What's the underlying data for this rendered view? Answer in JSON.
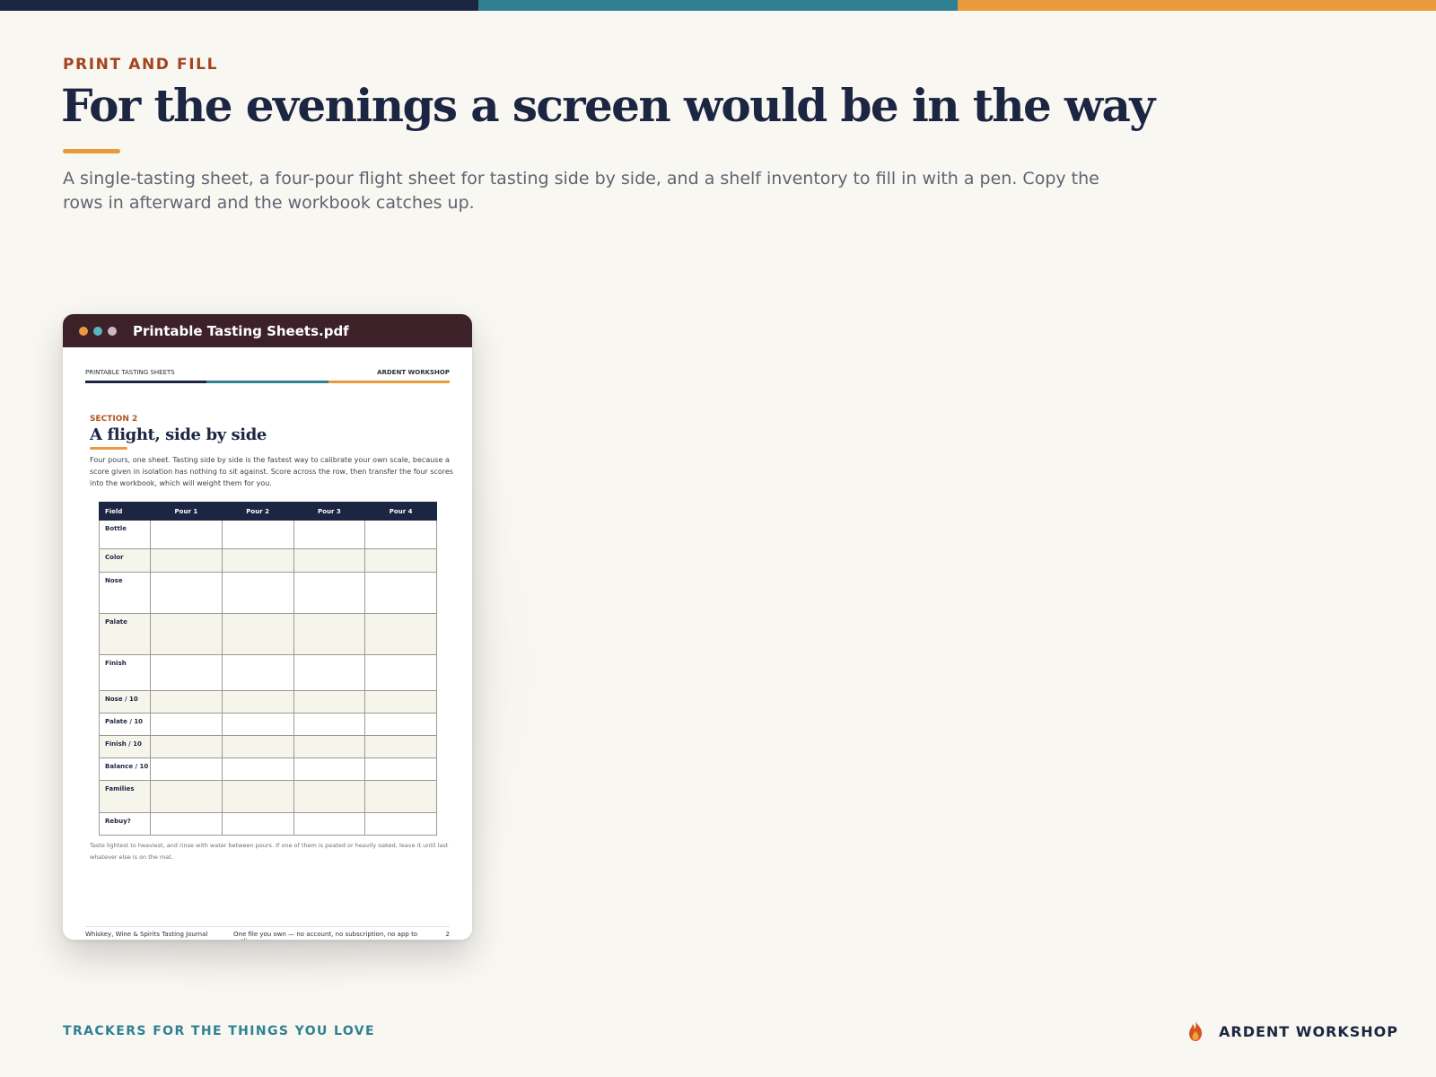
{
  "colors": {
    "navy": "#1c2541",
    "teal": "#2f8192",
    "orange": "#e89a3c",
    "rust": "#a4431f",
    "window_bar": "#3d2129"
  },
  "header": {
    "eyebrow": "PRINT AND FILL",
    "title": "For the evenings a screen would be in the way",
    "lead": "A single-tasting sheet, a four-pour flight sheet for tasting side by side, and a shelf inventory to fill in with a pen. Copy the rows in afterward and the workbook catches up."
  },
  "window": {
    "title": "Printable Tasting Sheets.pdf",
    "dots": [
      "#e89a3c",
      "#5ab6c2",
      "#c9b8c4"
    ]
  },
  "doc_page": {
    "header_left": "PRINTABLE TASTING SHEETS",
    "header_right": "ARDENT WORKSHOP",
    "section_label": "SECTION 2",
    "section_title": "A flight, side by side",
    "body": "Four pours, one sheet. Tasting side by side is the fastest way to calibrate your own scale, because a score given in isolation has nothing to sit against. Score across the row, then transfer the four scores into the workbook, which will weight them for you.",
    "table": {
      "headers": [
        "Field",
        "Pour 1",
        "Pour 2",
        "Pour 3",
        "Pour 4"
      ],
      "rows": [
        "Bottle",
        "Color",
        "Nose",
        "Palate",
        "Finish",
        "Nose / 10",
        "Palate / 10",
        "Finish / 10",
        "Balance / 10",
        "Families",
        "Rebuy?"
      ]
    },
    "note": "Taste lightest to heaviest, and rinse with water between pours. If one of them is peated or heavily oaked, leave it until last whatever else is on the mat.",
    "footer_left": "Whiskey, Wine & Spirits Tasting Journal",
    "footer_center": "One file you own — no account, no subscription, no app to outlive.",
    "footer_page": "2"
  },
  "footer": {
    "tagline": "TRACKERS FOR THE THINGS YOU LOVE",
    "brand": "ARDENT WORKSHOP",
    "brand_icon": "flame-icon"
  }
}
